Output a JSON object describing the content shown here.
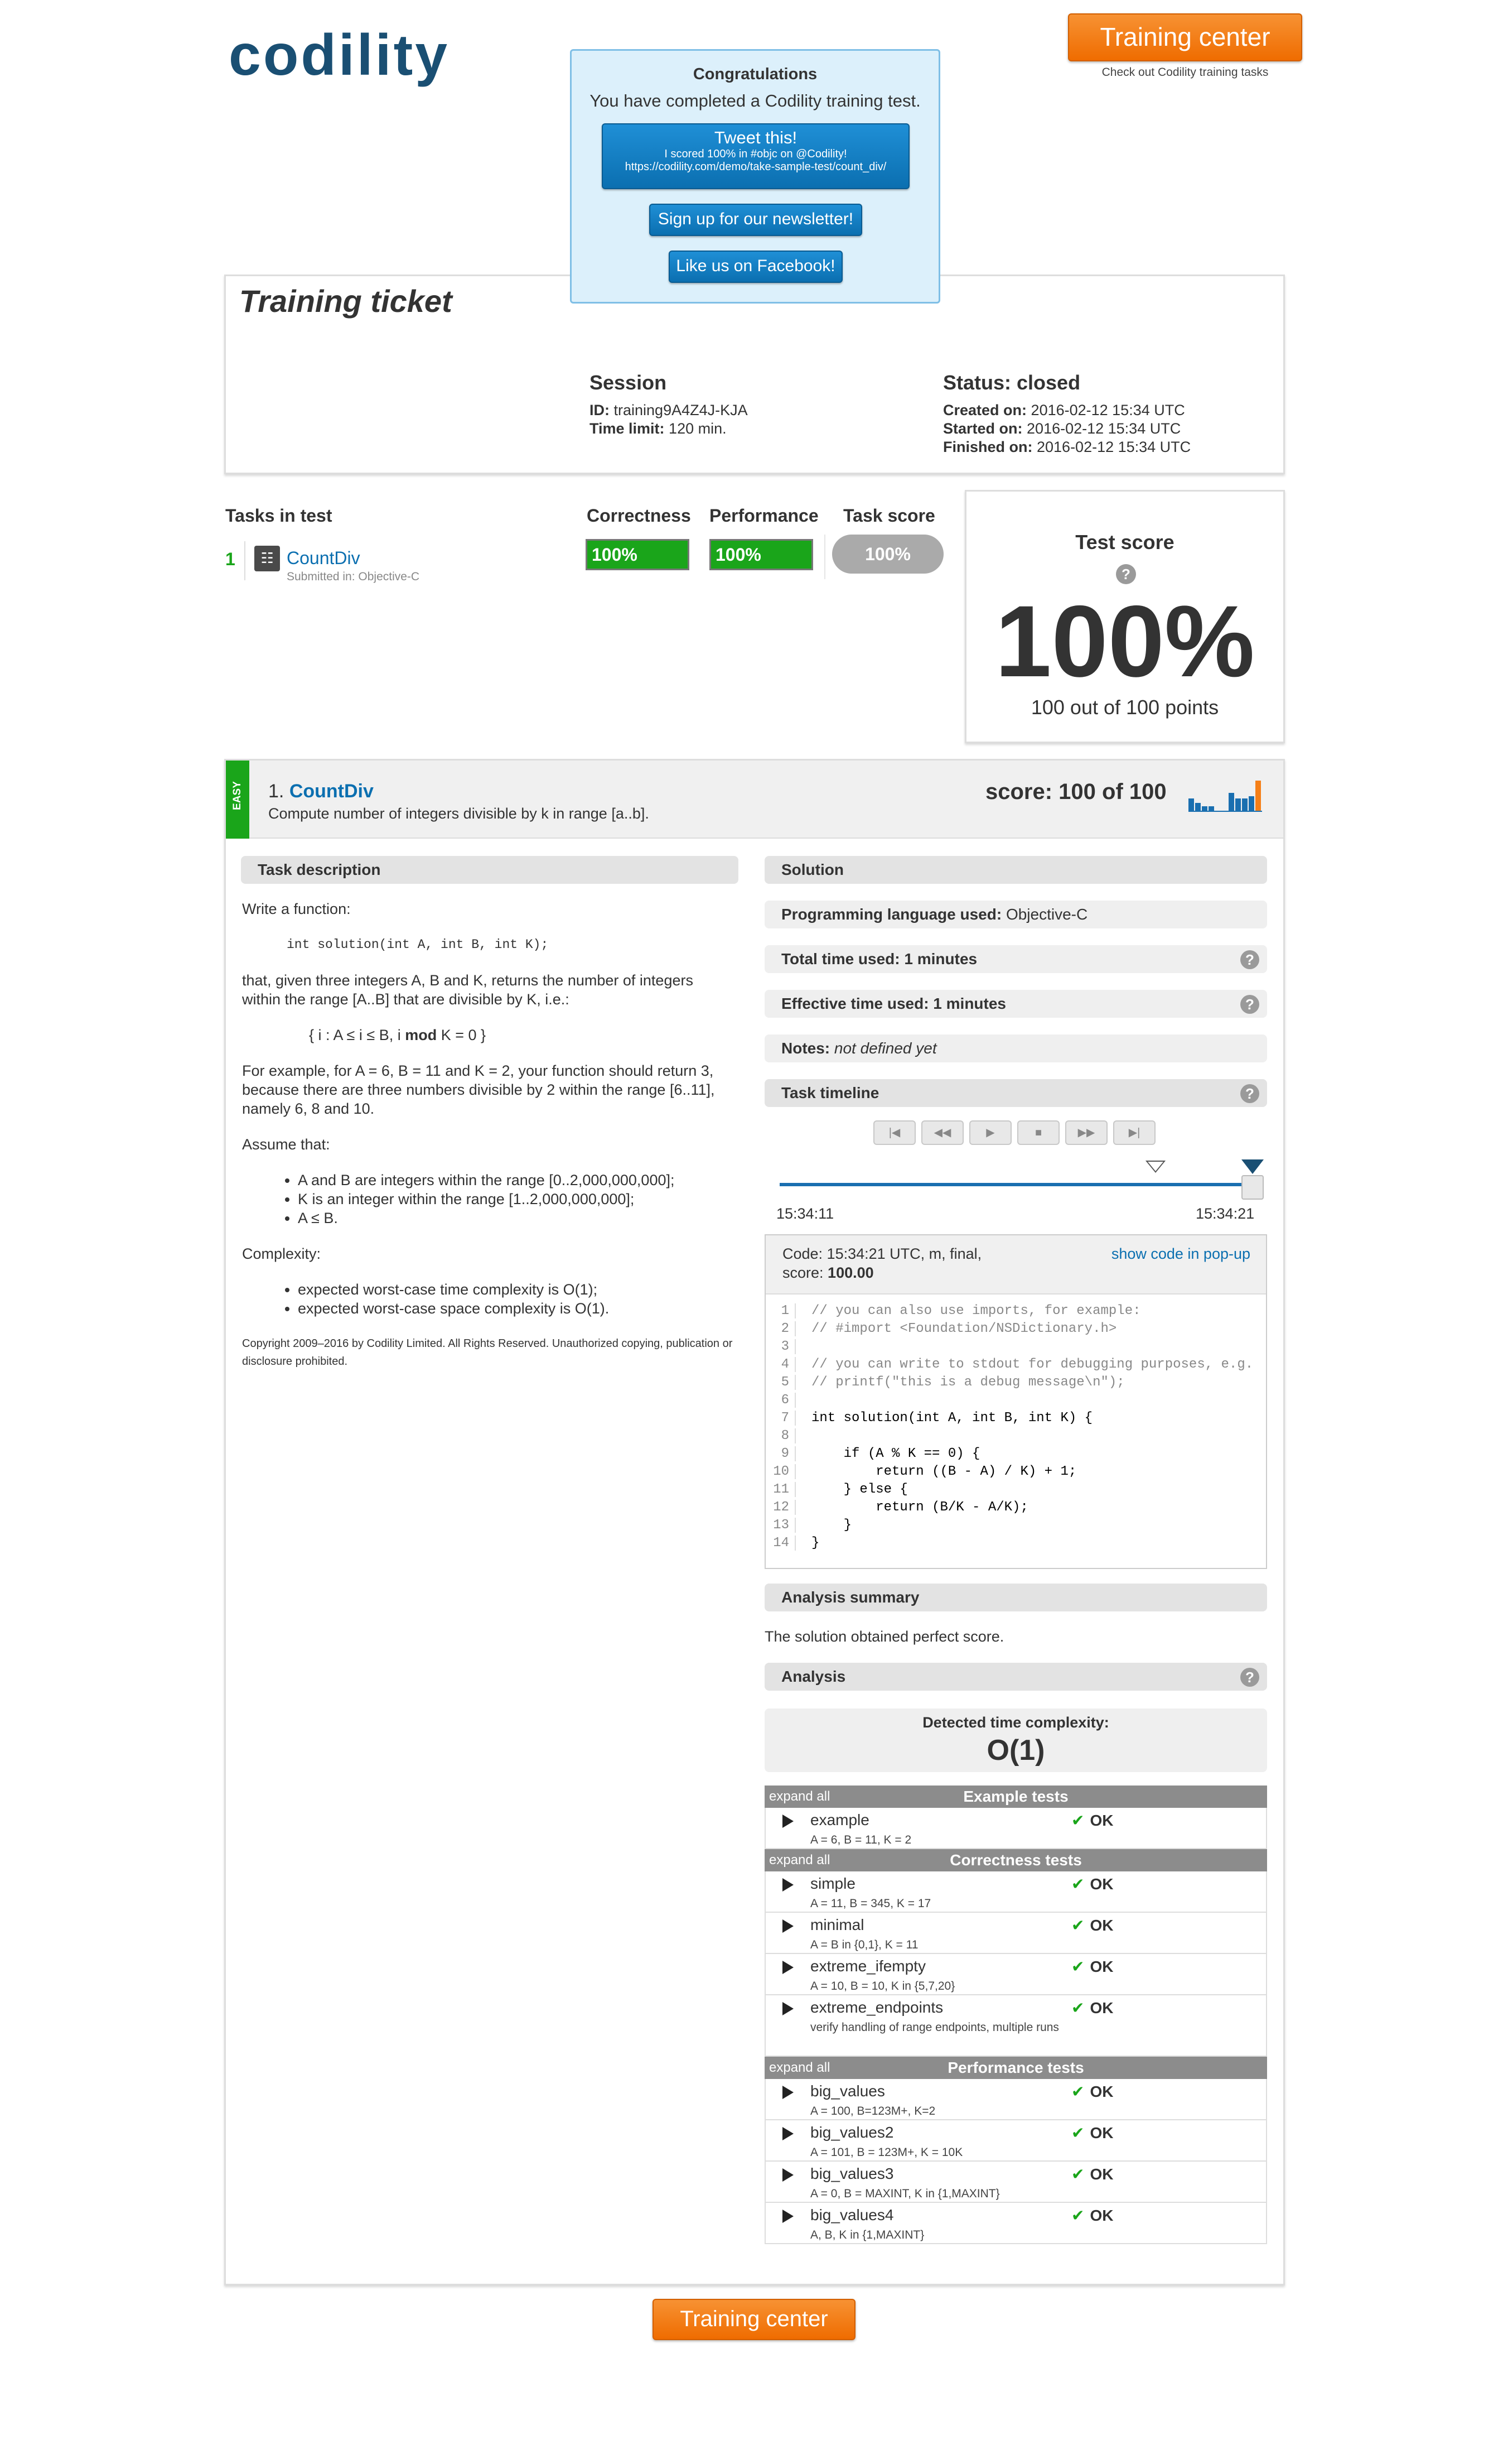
{
  "header": {
    "logo": "codility",
    "training_center": "Training center",
    "training_center_sub": "Check out Codility training tasks"
  },
  "popup": {
    "title": "Congratulations",
    "text": "You have completed a Codility training test.",
    "tweet_title": "Tweet this!",
    "tweet_line1": "I scored 100% in #objc on @Codility!",
    "tweet_line2": "https://codility.com/demo/take-sample-test/count_div/",
    "newsletter": "Sign up for our newsletter!",
    "facebook": "Like us on Facebook!"
  },
  "ticket": {
    "title": "Training ticket",
    "session_label": "Session",
    "id_label": "ID:",
    "id_value": "training9A4Z4J-KJA",
    "time_limit_label": "Time limit:",
    "time_limit_value": "120 min.",
    "status": "Status: closed",
    "created_label": "Created on:",
    "created_value": "2016-02-12 15:34 UTC",
    "started_label": "Started on:",
    "started_value": "2016-02-12 15:34 UTC",
    "finished_label": "Finished on:",
    "finished_value": "2016-02-12 15:34 UTC"
  },
  "tasks": {
    "heading": "Tasks in test",
    "correctness_label": "Correctness",
    "performance_label": "Performance",
    "task_score_label": "Task score",
    "num": "1",
    "name": "CountDiv",
    "submitted": "Submitted in: Objective-C",
    "correctness": "100%",
    "performance": "100%",
    "task_score": "100%"
  },
  "test_score": {
    "title": "Test score",
    "help": "?",
    "value": "100%",
    "points": "100 out of 100 points"
  },
  "task": {
    "difficulty": "EASY",
    "number": "1.",
    "name": "CountDiv",
    "summary": "Compute number of integers divisible by k in range [a..b].",
    "score": "score: 100 of 100"
  },
  "description": {
    "header": "Task description",
    "p1": "Write a function:",
    "signature": "int solution(int A, int B, int K);",
    "p2": "that, given three integers A, B and K, returns the number of integers within the range [A..B] that are divisible by K, i.e.:",
    "formula_pre": "{ i : A ≤ i ≤ B, i ",
    "formula_mod": "mod",
    "formula_post": " K = 0 }",
    "p3": "For example, for A = 6, B = 11 and K = 2, your function should return 3, because there are three numbers divisible by 2 within the range [6..11], namely 6, 8 and 10.",
    "assume": "Assume that:",
    "assumptions": [
      "A and B are integers within the range [0..2,000,000,000];",
      "K is an integer within the range [1..2,000,000,000];",
      "A ≤ B."
    ],
    "complexity": "Complexity:",
    "complexities": [
      "expected worst-case time complexity is O(1);",
      "expected worst-case space complexity is O(1)."
    ],
    "copyright": "Copyright 2009–2016 by Codility Limited. All Rights Reserved. Unauthorized copying, publication or disclosure prohibited."
  },
  "solution": {
    "header": "Solution",
    "lang_label": "Programming language used:",
    "lang_value": "Objective-C",
    "total_time": "Total time used: 1 minutes",
    "effective_time": "Effective time used: 1 minutes",
    "notes_label": "Notes:",
    "notes_value": "not defined yet",
    "timeline": "Task timeline",
    "time_start": "15:34:11",
    "time_end": "15:34:21",
    "code_info1": "Code: 15:34:21 UTC, m, final,",
    "code_info2_label": "score:",
    "code_info2_value": "100.00",
    "show_code": "show code in pop-up",
    "code_lines": [
      "// you can also use imports, for example:",
      "// #import <Foundation/NSDictionary.h>",
      "",
      "// you can write to stdout for debugging purposes, e.g.",
      "// printf(\"this is a debug message\\n\");",
      "",
      "int solution(int A, int B, int K) {",
      "",
      "    if (A % K == 0) {",
      "        return ((B - A) / K) + 1;",
      "    } else {",
      "        return (B/K - A/K);",
      "    }",
      "}"
    ],
    "analysis_summary": "Analysis summary",
    "summary_text": "The solution obtained perfect score.",
    "analysis": "Analysis",
    "complexity_label": "Detected time complexity:",
    "complexity_value": "O(1)"
  },
  "tests": {
    "expand": "expand all",
    "groups": [
      {
        "title": "Example tests",
        "rows": [
          {
            "name": "example",
            "desc": "A = 6, B = 11, K = 2",
            "result": "OK"
          }
        ]
      },
      {
        "title": "Correctness tests",
        "rows": [
          {
            "name": "simple",
            "desc": "A = 11, B = 345, K = 17",
            "result": "OK"
          },
          {
            "name": "minimal",
            "desc": "A = B in {0,1}, K = 11",
            "result": "OK"
          },
          {
            "name": "extreme_ifempty",
            "desc": "A = 10, B = 10, K in {5,7,20}",
            "result": "OK"
          },
          {
            "name": "extreme_endpoints",
            "desc": "verify handling of range endpoints, multiple runs",
            "result": "OK"
          }
        ]
      },
      {
        "title": "Performance tests",
        "rows": [
          {
            "name": "big_values",
            "desc": "A = 100, B=123M+, K=2",
            "result": "OK"
          },
          {
            "name": "big_values2",
            "desc": "A = 101, B = 123M+, K = 10K",
            "result": "OK"
          },
          {
            "name": "big_values3",
            "desc": "A = 0, B = MAXINT, K in {1,MAXINT}",
            "result": "OK"
          },
          {
            "name": "big_values4",
            "desc": "A, B, K in {1,MAXINT}",
            "result": "OK"
          }
        ]
      }
    ]
  },
  "footer": {
    "training_center": "Training center"
  },
  "colors": {
    "brand": "#1a4f73",
    "orange": "#f57f17",
    "green": "#1aa51a",
    "link": "#0b6fb0"
  },
  "icons": [
    "list-icon",
    "help-icon",
    "checkmark-icon",
    "expand-triangle-icon",
    "first-icon",
    "rewind-icon",
    "play-icon",
    "stop-icon",
    "forward-icon",
    "last-icon",
    "timeline-marker-icon",
    "score-chart-icon"
  ]
}
